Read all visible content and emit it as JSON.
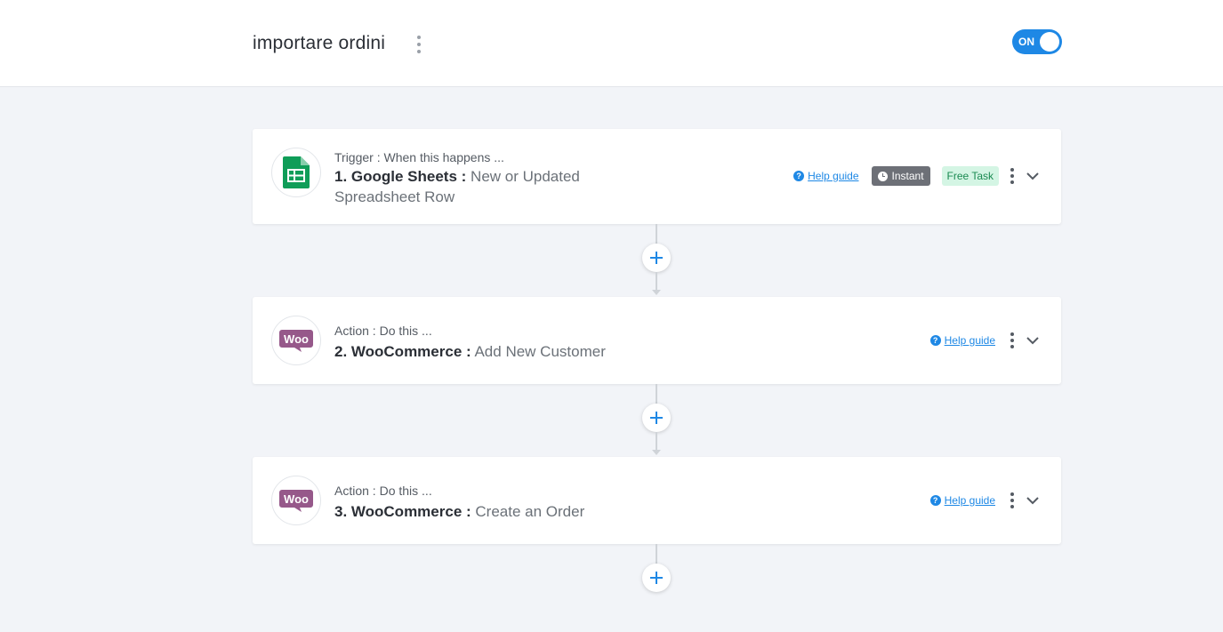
{
  "header": {
    "flow_title": "importare ordini",
    "toggle_label": "ON"
  },
  "steps": [
    {
      "type_label": "Trigger : When this happens ...",
      "app_label": "1. Google Sheets :",
      "event_label": "New or Updated Spreadsheet Row",
      "icon": "google-sheets-icon",
      "help_label": "Help guide",
      "instant_label": "Instant",
      "free_task_label": "Free Task"
    },
    {
      "type_label": "Action : Do this ...",
      "app_label": "2. WooCommerce :",
      "event_label": "Add New Customer",
      "icon": "woocommerce-icon",
      "help_label": "Help guide",
      "woo_text": "Woo"
    },
    {
      "type_label": "Action : Do this ...",
      "app_label": "3. WooCommerce :",
      "event_label": "Create an Order",
      "icon": "woocommerce-icon",
      "help_label": "Help guide",
      "woo_text": "Woo"
    }
  ],
  "colors": {
    "accent": "#1e88e5",
    "background": "#f2f4f8",
    "sheets_green": "#0f9d58",
    "woo_purple": "#96588a"
  }
}
